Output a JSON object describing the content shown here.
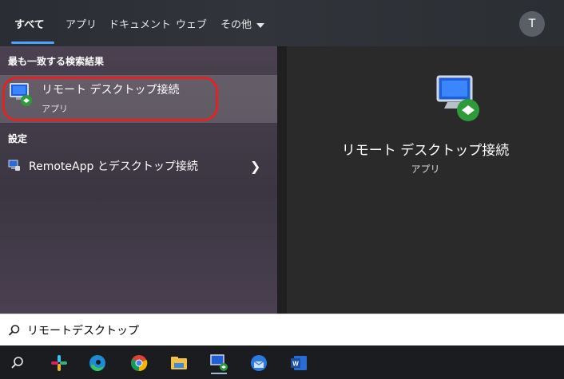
{
  "tabs": [
    {
      "label": "すべて"
    },
    {
      "label": "アプリ"
    },
    {
      "label": "ドキュメント"
    },
    {
      "label": "ウェブ"
    },
    {
      "label": "その他"
    }
  ],
  "user_initial": "T",
  "left": {
    "best_match_header": "最も一致する検索結果",
    "best_match": {
      "title": "リモート デスクトップ接続",
      "subtitle": "アプリ"
    },
    "settings_header": "設定",
    "settings_item": {
      "label": "RemoteApp とデスクトップ接続"
    }
  },
  "detail": {
    "title": "リモート デスクトップ接続",
    "subtitle": "アプリ"
  },
  "search": {
    "query": "リモートデスクトップ"
  },
  "colors": {
    "highlight_outline": "#e02424",
    "accent": "#4aa3ff"
  },
  "taskbar_icons": [
    "search-icon",
    "slack-icon",
    "edge-icon",
    "chrome-icon",
    "file-explorer-icon",
    "remote-desktop-icon",
    "outlook-icon",
    "word-icon"
  ]
}
